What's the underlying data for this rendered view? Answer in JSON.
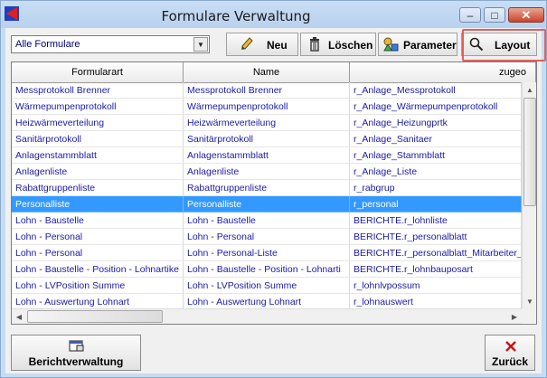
{
  "window": {
    "title": "Formulare Verwaltung",
    "minimize_glyph": "–",
    "maximize_glyph": "□",
    "close_glyph": "✕"
  },
  "toolbar": {
    "filter_value": "Alle Formulare",
    "new_label": "Neu",
    "delete_label": "Löschen",
    "parameter_label": "Parameter",
    "layout_label": "Layout"
  },
  "table": {
    "columns": [
      "Formularart",
      "Name",
      "zugeo"
    ],
    "selected_row": 7,
    "rows": [
      [
        "Messprotokoll Brenner",
        "Messprotokoll Brenner",
        "r_Anlage_Messprotokoll"
      ],
      [
        "Wärmepumpenprotokoll",
        "Wärmepumpenprotokoll",
        "r_Anlage_Wärmepumpenprotokoll"
      ],
      [
        "Heizwärmeverteilung",
        "Heizwärmeverteilung",
        "r_Anlage_Heizungprtk"
      ],
      [
        "Sanitärprotokoll",
        "Sanitärprotokoll",
        "r_Anlage_Sanitaer"
      ],
      [
        "Anlagenstammblatt",
        "Anlagenstammblatt",
        "r_Anlage_Stammblatt"
      ],
      [
        "Anlagenliste",
        "Anlagenliste",
        "r_Anlage_Liste"
      ],
      [
        "Rabattgruppenliste",
        "Rabattgruppenliste",
        "r_rabgrup"
      ],
      [
        "Personalliste",
        "Personalliste",
        "r_personal"
      ],
      [
        "Lohn - Baustelle",
        "Lohn - Baustelle",
        "BERICHTE.r_lohnliste"
      ],
      [
        "Lohn - Personal",
        "Lohn - Personal",
        "BERICHTE.r_personalblatt"
      ],
      [
        "Lohn - Personal",
        "Lohn - Personal-Liste",
        "BERICHTE.r_personalblatt_Mitarbeiter_"
      ],
      [
        "Lohn - Baustelle - Position - Lohnartike",
        "Lohn - Baustelle - Position - Lohnarti",
        "BERICHTE.r_lohnbauposart"
      ],
      [
        "Lohn - LVPosition Summe",
        "Lohn - LVPosition Summe",
        "r_lohnlvpossum"
      ],
      [
        "Lohn - Auswertung Lohnart",
        "Lohn - Auswertung Lohnart",
        "r_lohnauswert"
      ]
    ]
  },
  "footer": {
    "reports_label": "Berichtverwaltung",
    "back_label": "Zurück"
  },
  "colors": {
    "selection": "#3399ff",
    "cell_text": "#1a1aa8",
    "highlight_border": "#e06060",
    "close_red": "#d01010"
  }
}
